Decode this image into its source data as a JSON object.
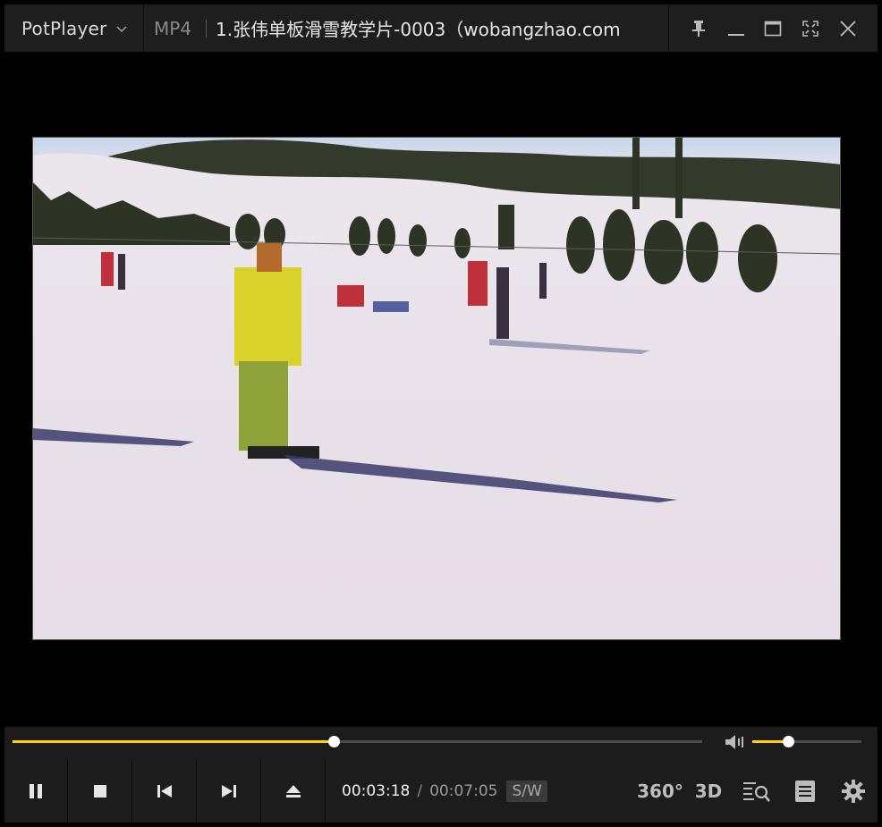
{
  "titlebar": {
    "app_name": "PotPlayer",
    "format": "MP4",
    "file_title": "1.张伟单板滑雪教学片-0003（wobangzhao.com"
  },
  "playback": {
    "current_time": "00:03:18",
    "separator": "/",
    "duration": "00:07:05",
    "mode_badge": "S/W",
    "progress_fraction": 0.466,
    "volume_fraction": 0.33
  },
  "right_controls": {
    "vr_label": "360°",
    "three_d_label": "3D"
  },
  "colors": {
    "accent": "#ffd200",
    "panel": "#1c1c1c",
    "titlebar": "#1e1e1e"
  }
}
